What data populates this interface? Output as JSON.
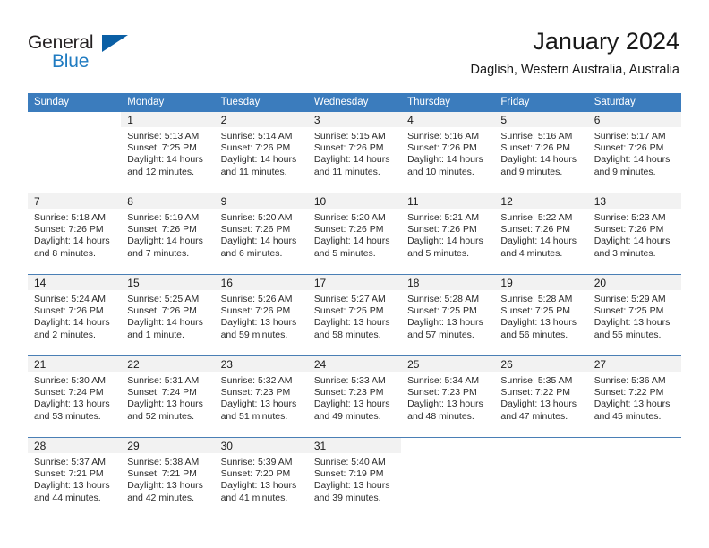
{
  "brand": {
    "name_part1": "General",
    "name_part2": "Blue",
    "flag_icon": "blue-triangle-flag-icon",
    "accent_color": "#1f7bc1"
  },
  "header": {
    "title": "January 2024",
    "subtitle": "Daglish, Western Australia, Australia"
  },
  "theme": {
    "header_blue": "#3b7cbd",
    "daynum_band": "#f2f2f2",
    "separator": "#4a7fb5"
  },
  "calendar": {
    "weekday_headers": [
      "Sunday",
      "Monday",
      "Tuesday",
      "Wednesday",
      "Thursday",
      "Friday",
      "Saturday"
    ],
    "weeks": [
      [
        {
          "day": "",
          "lines": []
        },
        {
          "day": "1",
          "lines": [
            "Sunrise: 5:13 AM",
            "Sunset: 7:25 PM",
            "Daylight: 14 hours",
            "and 12 minutes."
          ]
        },
        {
          "day": "2",
          "lines": [
            "Sunrise: 5:14 AM",
            "Sunset: 7:26 PM",
            "Daylight: 14 hours",
            "and 11 minutes."
          ]
        },
        {
          "day": "3",
          "lines": [
            "Sunrise: 5:15 AM",
            "Sunset: 7:26 PM",
            "Daylight: 14 hours",
            "and 11 minutes."
          ]
        },
        {
          "day": "4",
          "lines": [
            "Sunrise: 5:16 AM",
            "Sunset: 7:26 PM",
            "Daylight: 14 hours",
            "and 10 minutes."
          ]
        },
        {
          "day": "5",
          "lines": [
            "Sunrise: 5:16 AM",
            "Sunset: 7:26 PM",
            "Daylight: 14 hours",
            "and 9 minutes."
          ]
        },
        {
          "day": "6",
          "lines": [
            "Sunrise: 5:17 AM",
            "Sunset: 7:26 PM",
            "Daylight: 14 hours",
            "and 9 minutes."
          ]
        }
      ],
      [
        {
          "day": "7",
          "lines": [
            "Sunrise: 5:18 AM",
            "Sunset: 7:26 PM",
            "Daylight: 14 hours",
            "and 8 minutes."
          ]
        },
        {
          "day": "8",
          "lines": [
            "Sunrise: 5:19 AM",
            "Sunset: 7:26 PM",
            "Daylight: 14 hours",
            "and 7 minutes."
          ]
        },
        {
          "day": "9",
          "lines": [
            "Sunrise: 5:20 AM",
            "Sunset: 7:26 PM",
            "Daylight: 14 hours",
            "and 6 minutes."
          ]
        },
        {
          "day": "10",
          "lines": [
            "Sunrise: 5:20 AM",
            "Sunset: 7:26 PM",
            "Daylight: 14 hours",
            "and 5 minutes."
          ]
        },
        {
          "day": "11",
          "lines": [
            "Sunrise: 5:21 AM",
            "Sunset: 7:26 PM",
            "Daylight: 14 hours",
            "and 5 minutes."
          ]
        },
        {
          "day": "12",
          "lines": [
            "Sunrise: 5:22 AM",
            "Sunset: 7:26 PM",
            "Daylight: 14 hours",
            "and 4 minutes."
          ]
        },
        {
          "day": "13",
          "lines": [
            "Sunrise: 5:23 AM",
            "Sunset: 7:26 PM",
            "Daylight: 14 hours",
            "and 3 minutes."
          ]
        }
      ],
      [
        {
          "day": "14",
          "lines": [
            "Sunrise: 5:24 AM",
            "Sunset: 7:26 PM",
            "Daylight: 14 hours",
            "and 2 minutes."
          ]
        },
        {
          "day": "15",
          "lines": [
            "Sunrise: 5:25 AM",
            "Sunset: 7:26 PM",
            "Daylight: 14 hours",
            "and 1 minute."
          ]
        },
        {
          "day": "16",
          "lines": [
            "Sunrise: 5:26 AM",
            "Sunset: 7:26 PM",
            "Daylight: 13 hours",
            "and 59 minutes."
          ]
        },
        {
          "day": "17",
          "lines": [
            "Sunrise: 5:27 AM",
            "Sunset: 7:25 PM",
            "Daylight: 13 hours",
            "and 58 minutes."
          ]
        },
        {
          "day": "18",
          "lines": [
            "Sunrise: 5:28 AM",
            "Sunset: 7:25 PM",
            "Daylight: 13 hours",
            "and 57 minutes."
          ]
        },
        {
          "day": "19",
          "lines": [
            "Sunrise: 5:28 AM",
            "Sunset: 7:25 PM",
            "Daylight: 13 hours",
            "and 56 minutes."
          ]
        },
        {
          "day": "20",
          "lines": [
            "Sunrise: 5:29 AM",
            "Sunset: 7:25 PM",
            "Daylight: 13 hours",
            "and 55 minutes."
          ]
        }
      ],
      [
        {
          "day": "21",
          "lines": [
            "Sunrise: 5:30 AM",
            "Sunset: 7:24 PM",
            "Daylight: 13 hours",
            "and 53 minutes."
          ]
        },
        {
          "day": "22",
          "lines": [
            "Sunrise: 5:31 AM",
            "Sunset: 7:24 PM",
            "Daylight: 13 hours",
            "and 52 minutes."
          ]
        },
        {
          "day": "23",
          "lines": [
            "Sunrise: 5:32 AM",
            "Sunset: 7:23 PM",
            "Daylight: 13 hours",
            "and 51 minutes."
          ]
        },
        {
          "day": "24",
          "lines": [
            "Sunrise: 5:33 AM",
            "Sunset: 7:23 PM",
            "Daylight: 13 hours",
            "and 49 minutes."
          ]
        },
        {
          "day": "25",
          "lines": [
            "Sunrise: 5:34 AM",
            "Sunset: 7:23 PM",
            "Daylight: 13 hours",
            "and 48 minutes."
          ]
        },
        {
          "day": "26",
          "lines": [
            "Sunrise: 5:35 AM",
            "Sunset: 7:22 PM",
            "Daylight: 13 hours",
            "and 47 minutes."
          ]
        },
        {
          "day": "27",
          "lines": [
            "Sunrise: 5:36 AM",
            "Sunset: 7:22 PM",
            "Daylight: 13 hours",
            "and 45 minutes."
          ]
        }
      ],
      [
        {
          "day": "28",
          "lines": [
            "Sunrise: 5:37 AM",
            "Sunset: 7:21 PM",
            "Daylight: 13 hours",
            "and 44 minutes."
          ]
        },
        {
          "day": "29",
          "lines": [
            "Sunrise: 5:38 AM",
            "Sunset: 7:21 PM",
            "Daylight: 13 hours",
            "and 42 minutes."
          ]
        },
        {
          "day": "30",
          "lines": [
            "Sunrise: 5:39 AM",
            "Sunset: 7:20 PM",
            "Daylight: 13 hours",
            "and 41 minutes."
          ]
        },
        {
          "day": "31",
          "lines": [
            "Sunrise: 5:40 AM",
            "Sunset: 7:19 PM",
            "Daylight: 13 hours",
            "and 39 minutes."
          ]
        },
        {
          "day": "",
          "lines": []
        },
        {
          "day": "",
          "lines": []
        },
        {
          "day": "",
          "lines": []
        }
      ]
    ]
  }
}
